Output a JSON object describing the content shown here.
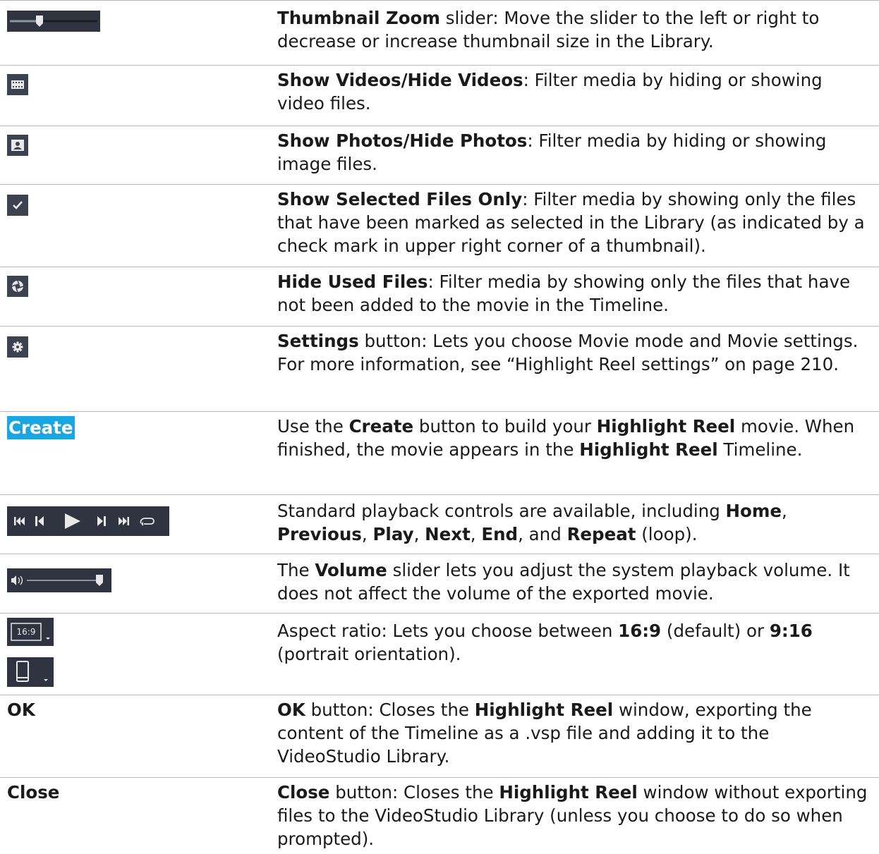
{
  "rows": [
    {
      "name": "Thumbnail Zoom",
      "desc_parts": [
        "Thumbnail Zoom",
        " slider: Move the slider to the left or right to decrease or increase thumbnail size in the Library."
      ],
      "icon": "thumbnail-zoom-slider"
    },
    {
      "desc_parts": [
        "Show Videos/Hide Videos",
        ": Filter media by hiding or showing video files."
      ],
      "icon": "filmstrip-icon"
    },
    {
      "desc_parts": [
        "Show Photos/Hide Photos",
        ": Filter media by hiding or showing image files."
      ],
      "icon": "photo-icon"
    },
    {
      "desc_parts": [
        "Show Selected Files Only",
        ": Filter media by showing only the files that have been marked as selected in the Library (as indicated by a check mark in upper right corner of a thumbnail)."
      ],
      "icon": "check-icon"
    },
    {
      "desc_parts": [
        "Hide Used Files",
        ": Filter media by showing only the files that have not been added to the movie in the Timeline."
      ],
      "icon": "aperture-icon"
    },
    {
      "desc_parts": [
        "Settings",
        " button: Lets you choose Movie mode and Movie settings. For more information, see “Highlight Reel settings” on page 210."
      ],
      "icon": "gear-icon"
    },
    {
      "label": "Create",
      "desc": {
        "a": "Use the ",
        "b": "Create",
        "c": " button to build your ",
        "d": "Highlight Reel",
        "e": " movie. When finished, the movie appears in the ",
        "f": "Highlight Reel",
        "g": " Timeline."
      }
    },
    {
      "desc": {
        "a": "Standard playback controls are available, including ",
        "b": "Home",
        "c": ", ",
        "d": "Previous",
        "e": ", ",
        "f": "Play",
        "g": ", ",
        "h": "Next",
        "i": ", ",
        "j": "End",
        "k": ", and ",
        "l": "Repeat",
        "m": " (loop)."
      }
    },
    {
      "desc": {
        "a": "The ",
        "b": "Volume",
        "c": " slider lets you adjust the system playback volume. It does not affect the volume of the exported movie."
      }
    },
    {
      "icon_label": "16:9",
      "desc": {
        "a": "Aspect ratio: Lets you choose between ",
        "b": "16:9",
        "c": " (default) or ",
        "d": "9:16",
        "e": " (portrait orientation)."
      }
    },
    {
      "label": "OK",
      "desc": {
        "a": "OK",
        "b": " button: Closes the ",
        "c": "Highlight Reel",
        "d": " window, exporting the content of the Timeline as a .vsp file and adding it to the VideoStudio Library."
      }
    },
    {
      "label": "Close",
      "desc": {
        "a": "Close",
        "b": " button: Closes the ",
        "c": "Highlight Reel",
        "d": " window without exporting files to the VideoStudio Library (unless you choose to do so when prompted)."
      }
    }
  ],
  "colors": {
    "icon_bg": "#2f3440",
    "create_bg": "#1aa6e0",
    "border": "#b9b9b9"
  }
}
